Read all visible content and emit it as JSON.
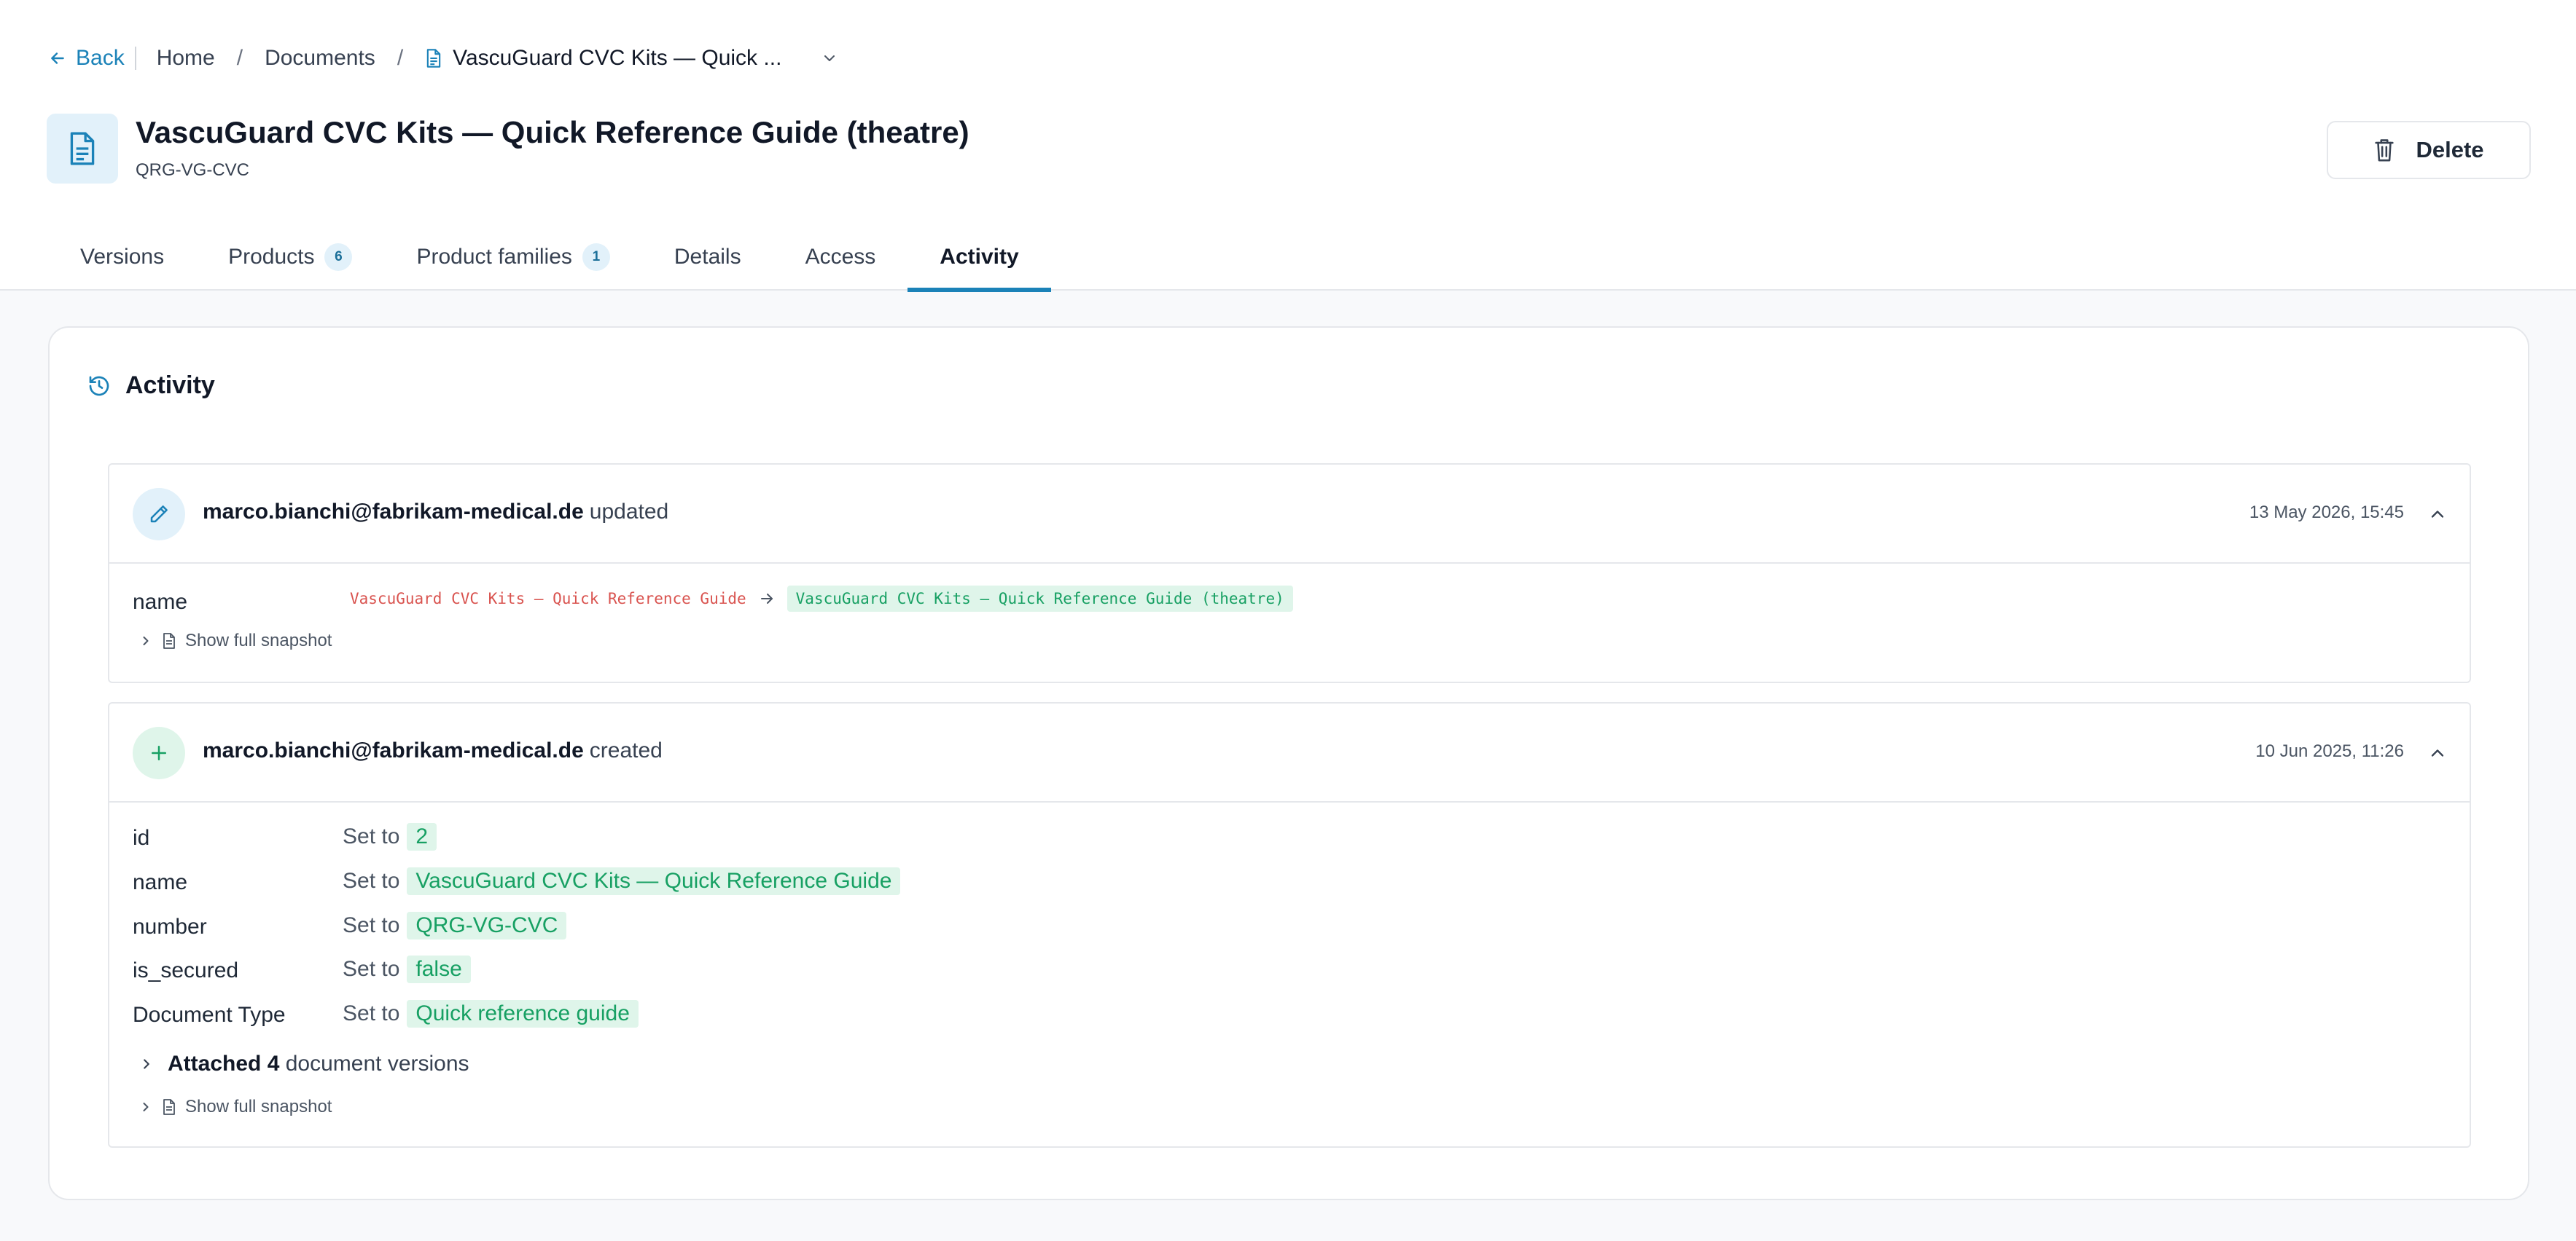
{
  "breadcrumb": {
    "back": "Back",
    "home": "Home",
    "documents": "Documents",
    "current": "VascuGuard CVC Kits — Quick ..."
  },
  "page": {
    "title": "VascuGuard CVC Kits — Quick Reference Guide (theatre)",
    "subtitle": "QRG-VG-CVC",
    "delete_label": "Delete"
  },
  "tabs": [
    {
      "label": "Versions"
    },
    {
      "label": "Products",
      "badge": "6"
    },
    {
      "label": "Product families",
      "badge": "1"
    },
    {
      "label": "Details"
    },
    {
      "label": "Access"
    },
    {
      "label": "Activity",
      "active": true
    }
  ],
  "activity": {
    "heading": "Activity",
    "entries": [
      {
        "user": "marco.bianchi@fabrikam-medical.de",
        "action": "updated",
        "timestamp": "13 May 2026, 15:45",
        "change": {
          "field": "name",
          "old": "VascuGuard CVC Kits — Quick Reference Guide",
          "new": "VascuGuard CVC Kits — Quick Reference Guide (theatre)"
        },
        "snapshot_label": "Show full snapshot"
      },
      {
        "user": "marco.bianchi@fabrikam-medical.de",
        "action": "created",
        "timestamp": "10 Jun 2025, 11:26",
        "set_prefix": "Set to",
        "fields": [
          {
            "name": "id",
            "value": "2"
          },
          {
            "name": "name",
            "value": "VascuGuard CVC Kits — Quick Reference Guide"
          },
          {
            "name": "number",
            "value": "QRG-VG-CVC"
          },
          {
            "name": "is_secured",
            "value": "false"
          },
          {
            "name": "Document Type",
            "value": "Quick reference guide"
          }
        ],
        "attached_prefix": "Attached",
        "attached_count": "4",
        "attached_suffix": "document versions",
        "snapshot_label": "Show full snapshot"
      }
    ]
  },
  "colors": {
    "accent": "#1b82b8",
    "added": "#17a063",
    "removed": "#d9534f"
  }
}
